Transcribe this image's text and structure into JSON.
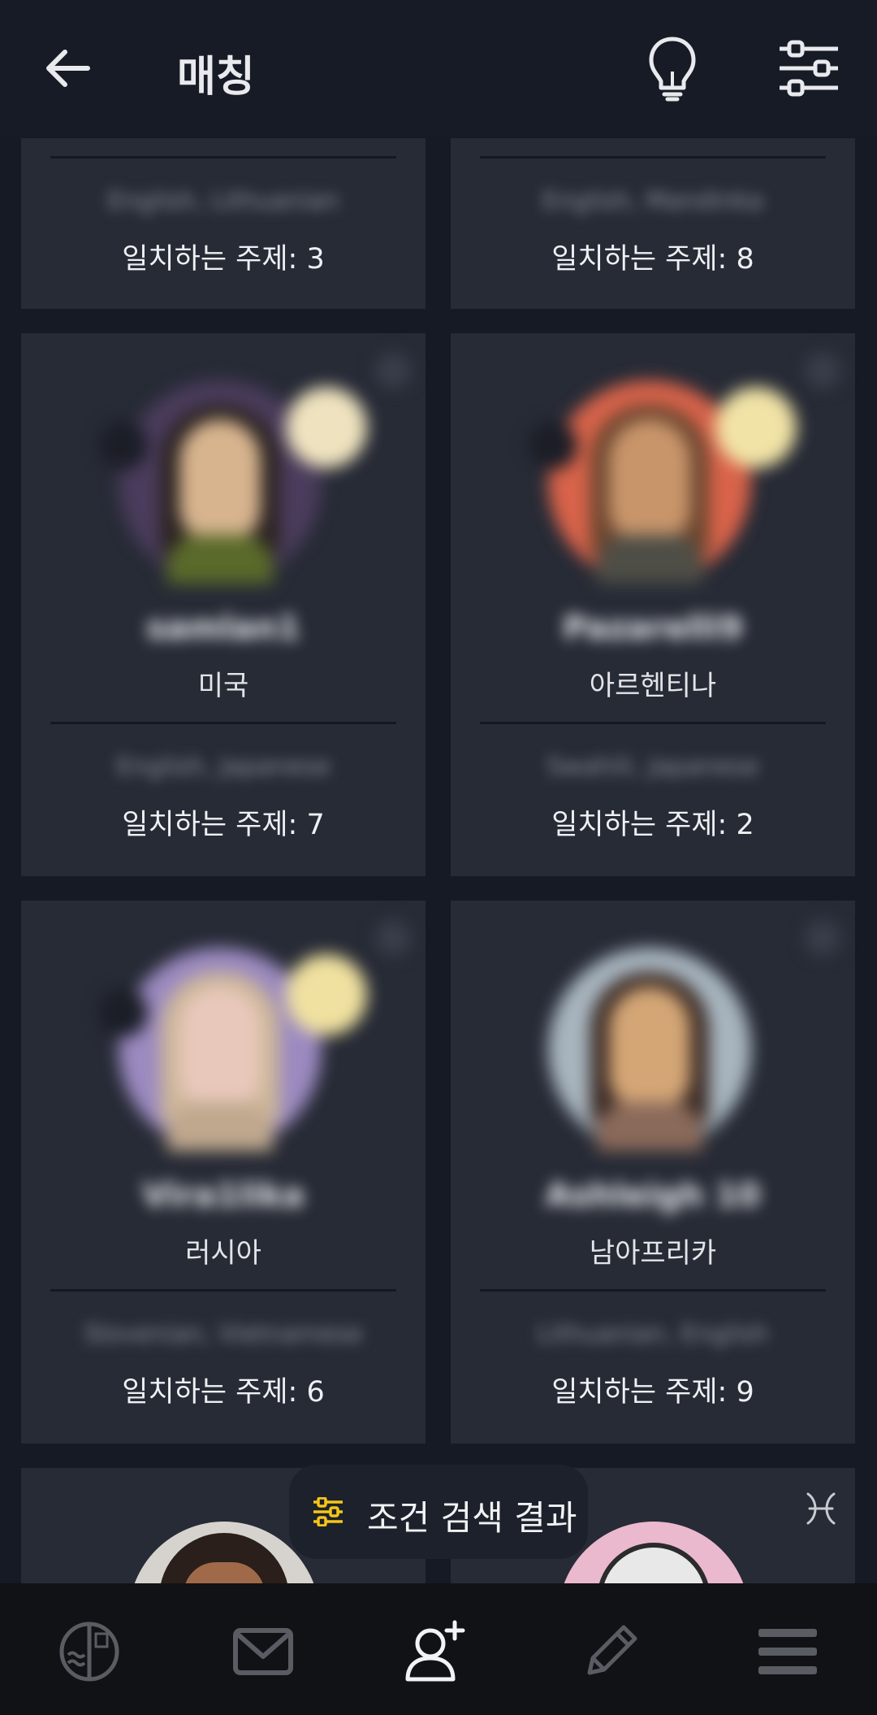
{
  "header": {
    "title": "매칭"
  },
  "cards": {
    "top_left": {
      "langs": "English, Lithuanian",
      "match": "일치하는 주제: 3"
    },
    "top_right": {
      "langs": "English, Mandinka",
      "match": "일치하는 주제: 8"
    },
    "r2_left": {
      "name": "samlan1",
      "country": "미국",
      "langs": "English, Japanese",
      "match": "일치하는 주제: 7"
    },
    "r2_right": {
      "name": "Pazarelli9",
      "country": "아르헨티나",
      "langs": "Swahili, Japanese",
      "match": "일치하는 주제: 2"
    },
    "r3_left": {
      "name": "Vira1lika",
      "country": "러시아",
      "langs": "Slovenian, Vietnamese",
      "match": "일치하는 주제: 6"
    },
    "r3_right": {
      "name": "Ashleigh 10",
      "country": "남아프리카",
      "langs": "Lithuanian, English",
      "match": "일치하는 주제: 9"
    }
  },
  "floating": {
    "label": "조건 검색 결과"
  },
  "colors": {
    "background": "#161a24",
    "card": "#272b36",
    "accent": "#f5c518",
    "nav": "#111215"
  },
  "icons": [
    "back-arrow-icon",
    "lightbulb-icon",
    "sliders-icon",
    "zodiac-pisces-icon",
    "horoscope-icon",
    "mail-icon",
    "add-user-icon",
    "pencil-icon",
    "menu-icon"
  ]
}
